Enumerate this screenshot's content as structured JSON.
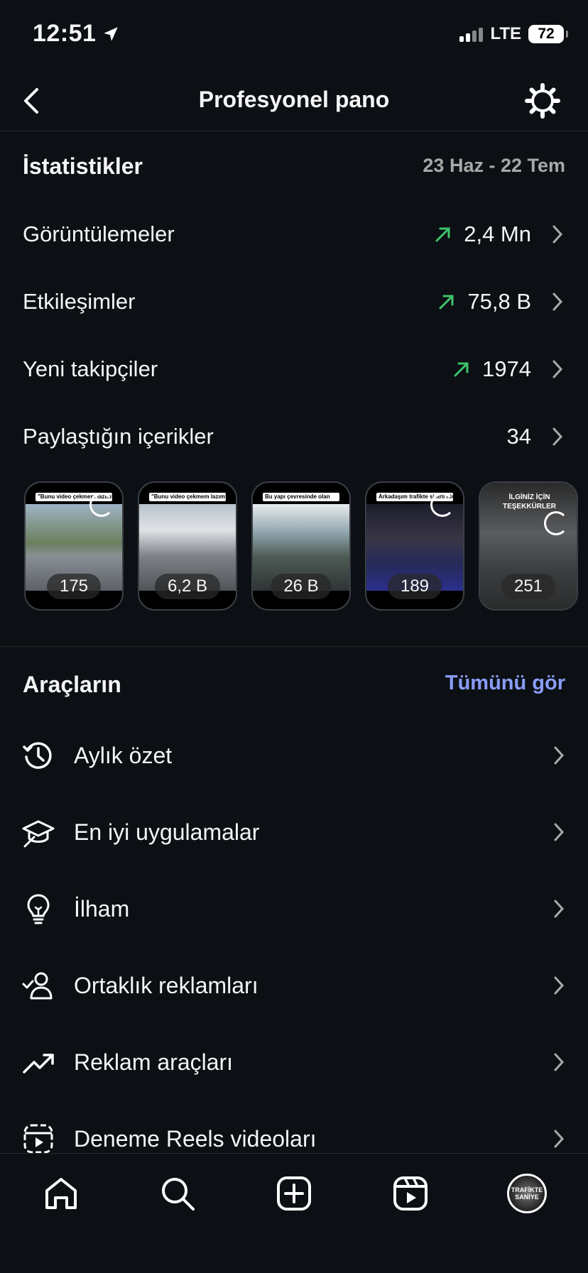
{
  "status": {
    "time": "12:51",
    "network": "LTE",
    "battery": "72"
  },
  "header": {
    "title": "Profesyonel pano"
  },
  "stats": {
    "title": "İstatistikler",
    "date_range": "23 Haz - 22 Tem",
    "rows": [
      {
        "label": "Görüntülemeler",
        "value": "2,4 Mn",
        "trend": "up"
      },
      {
        "label": "Etkileşimler",
        "value": "75,8 B",
        "trend": "up"
      },
      {
        "label": "Yeni takipçiler",
        "value": "1974",
        "trend": "up"
      },
      {
        "label": "Paylaştığın içerikler",
        "value": "34",
        "trend": "none"
      }
    ]
  },
  "content_thumbnails": [
    {
      "count": "175",
      "caption": "\"Bunu video çekmem lazım!\""
    },
    {
      "count": "6,2 B",
      "caption": "\"Bunu video çekmem lazım!\""
    },
    {
      "count": "26 B",
      "caption": "Bu yapı çevresinde olan"
    },
    {
      "count": "189",
      "caption": "Arkadaşım trafikte sinirli nince"
    },
    {
      "count": "251",
      "caption": "İLGİNİZ İÇİN TEŞEKKÜRLER"
    }
  ],
  "tools": {
    "title": "Araçların",
    "see_all": "Tümünü gör",
    "items": [
      {
        "label": "Aylık özet",
        "icon": "history-icon"
      },
      {
        "label": "En iyi uygulamalar",
        "icon": "graduation-cap-icon"
      },
      {
        "label": "İlham",
        "icon": "lightbulb-icon"
      },
      {
        "label": "Ortaklık reklamları",
        "icon": "partner-check-icon"
      },
      {
        "label": "Reklam araçları",
        "icon": "trend-up-icon"
      },
      {
        "label": "Deneme Reels videoları",
        "icon": "reels-icon"
      }
    ]
  },
  "colors": {
    "background": "#0c1014",
    "accent_link": "#8b9cf9",
    "trend_up": "#3ec46d"
  },
  "tabbar": {
    "tabs": [
      "home-icon",
      "search-icon",
      "create-icon",
      "reels-icon",
      "profile-avatar"
    ],
    "avatar_text": "TRAFİKTE SANİYE"
  }
}
